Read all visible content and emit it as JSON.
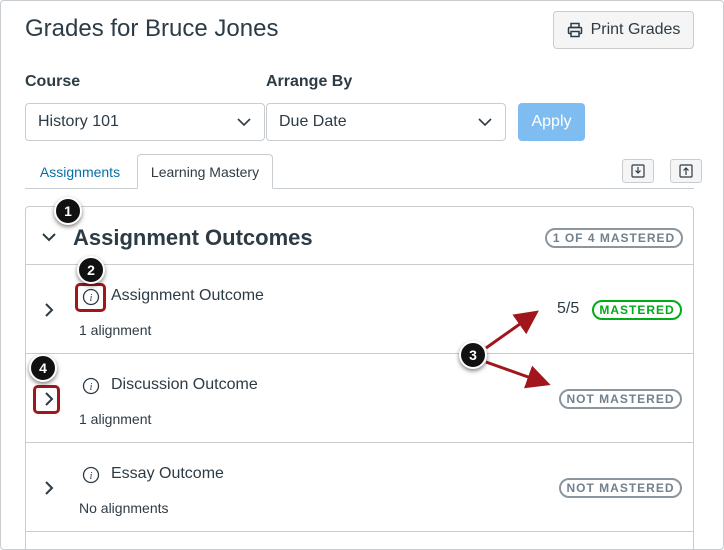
{
  "header": {
    "title": "Grades for Bruce Jones",
    "print_label": "Print Grades"
  },
  "filters": {
    "course_label": "Course",
    "course_value": "History 101",
    "arrange_label": "Arrange By",
    "arrange_value": "Due Date",
    "apply_label": "Apply"
  },
  "tabs": [
    {
      "label": "Assignments"
    },
    {
      "label": "Learning Mastery"
    }
  ],
  "group": {
    "title": "Assignment Outcomes",
    "summary": "1 OF 4 MASTERED"
  },
  "outcomes": [
    {
      "title": "Assignment Outcome",
      "alignments": "1 alignment",
      "score": "5/5",
      "status": "MASTERED"
    },
    {
      "title": "Discussion Outcome",
      "alignments": "1 alignment",
      "score": "",
      "status": "NOT MASTERED"
    },
    {
      "title": "Essay Outcome",
      "alignments": "No alignments",
      "score": "",
      "status": "NOT MASTERED"
    }
  ],
  "callouts": [
    "1",
    "2",
    "3",
    "4"
  ],
  "colors": {
    "link": "#0770a3",
    "apply_disabled": "#7fbdf0",
    "mastered": "#00ac18",
    "not_mastered": "#73818c",
    "annotation": "#a1161b"
  },
  "icons": [
    "printer-icon",
    "chevron-down-icon",
    "import-icon",
    "export-icon",
    "info-icon",
    "chevron-right-icon"
  ]
}
